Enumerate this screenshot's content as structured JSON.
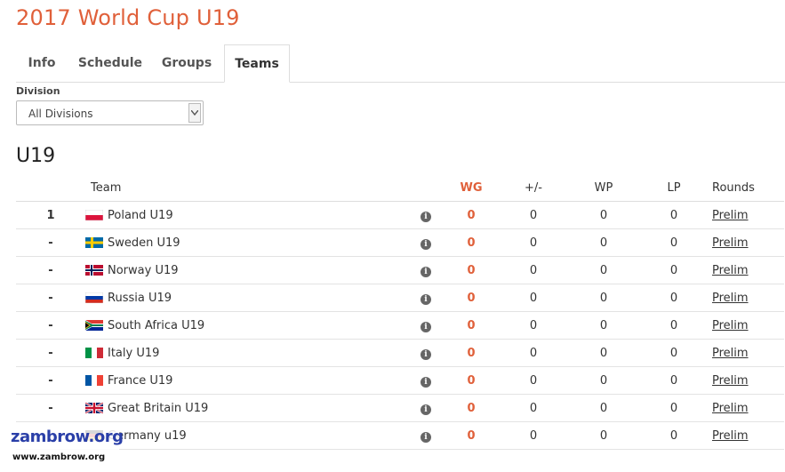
{
  "page": {
    "title": "2017 World Cup U19"
  },
  "tabs": [
    {
      "label": "Info",
      "active": false
    },
    {
      "label": "Schedule",
      "active": false
    },
    {
      "label": "Groups",
      "active": false
    },
    {
      "label": "Teams",
      "active": true
    }
  ],
  "division": {
    "label": "Division",
    "selected": "All Divisions"
  },
  "section": {
    "title": "U19"
  },
  "table": {
    "headers": {
      "team": "Team",
      "wg": "WG",
      "pm": "+/-",
      "wp": "WP",
      "lp": "LP",
      "rounds": "Rounds"
    },
    "rows": [
      {
        "rank": "1",
        "flag": "poland",
        "team": "Poland U19",
        "wg": "0",
        "pm": "0",
        "wp": "0",
        "lp": "0",
        "round": "Prelim"
      },
      {
        "rank": "-",
        "flag": "sweden",
        "team": "Sweden U19",
        "wg": "0",
        "pm": "0",
        "wp": "0",
        "lp": "0",
        "round": "Prelim"
      },
      {
        "rank": "-",
        "flag": "norway",
        "team": "Norway U19",
        "wg": "0",
        "pm": "0",
        "wp": "0",
        "lp": "0",
        "round": "Prelim"
      },
      {
        "rank": "-",
        "flag": "russia",
        "team": "Russia U19",
        "wg": "0",
        "pm": "0",
        "wp": "0",
        "lp": "0",
        "round": "Prelim"
      },
      {
        "rank": "-",
        "flag": "south-africa",
        "team": "South Africa U19",
        "wg": "0",
        "pm": "0",
        "wp": "0",
        "lp": "0",
        "round": "Prelim"
      },
      {
        "rank": "-",
        "flag": "italy",
        "team": "Italy U19",
        "wg": "0",
        "pm": "0",
        "wp": "0",
        "lp": "0",
        "round": "Prelim"
      },
      {
        "rank": "-",
        "flag": "france",
        "team": "France U19",
        "wg": "0",
        "pm": "0",
        "wp": "0",
        "lp": "0",
        "round": "Prelim"
      },
      {
        "rank": "-",
        "flag": "great-britain",
        "team": "Great Britain U19",
        "wg": "0",
        "pm": "0",
        "wp": "0",
        "lp": "0",
        "round": "Prelim"
      },
      {
        "rank": "",
        "flag": "germany",
        "team": "Germany u19",
        "wg": "0",
        "pm": "0",
        "wp": "0",
        "lp": "0",
        "round": "Prelim"
      }
    ]
  },
  "watermark": {
    "brand": "zambrow.org",
    "url": "www.zambrow.org"
  },
  "colors": {
    "accent": "#e0603a",
    "brand_blue": "#2a3fa8"
  }
}
